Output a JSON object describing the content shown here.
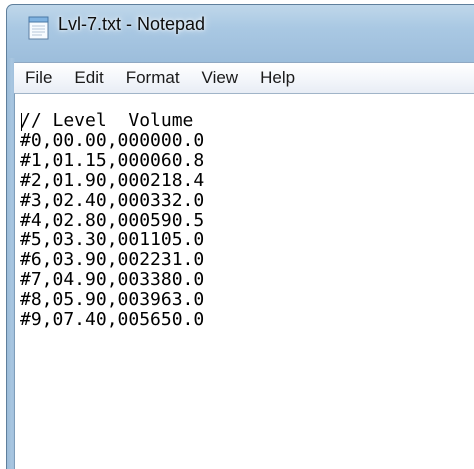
{
  "window": {
    "title": "Lvl-7.txt - Notepad",
    "app_icon": "notepad-icon",
    "frame_color": "#a9c8e3"
  },
  "menu": {
    "items": [
      {
        "label": "File"
      },
      {
        "label": "Edit"
      },
      {
        "label": "Format"
      },
      {
        "label": "View"
      },
      {
        "label": "Help"
      }
    ]
  },
  "editor": {
    "lines": [
      "// Level  Volume",
      "#0,00.00,000000.0",
      "#1,01.15,000060.8",
      "#2,01.90,000218.4",
      "#3,02.40,000332.0",
      "#4,02.80,000590.5",
      "#5,03.30,001105.0",
      "#6,03.90,002231.0",
      "#7,04.90,003380.0",
      "#8,05.90,003963.0",
      "#9,07.40,005650.0"
    ]
  }
}
